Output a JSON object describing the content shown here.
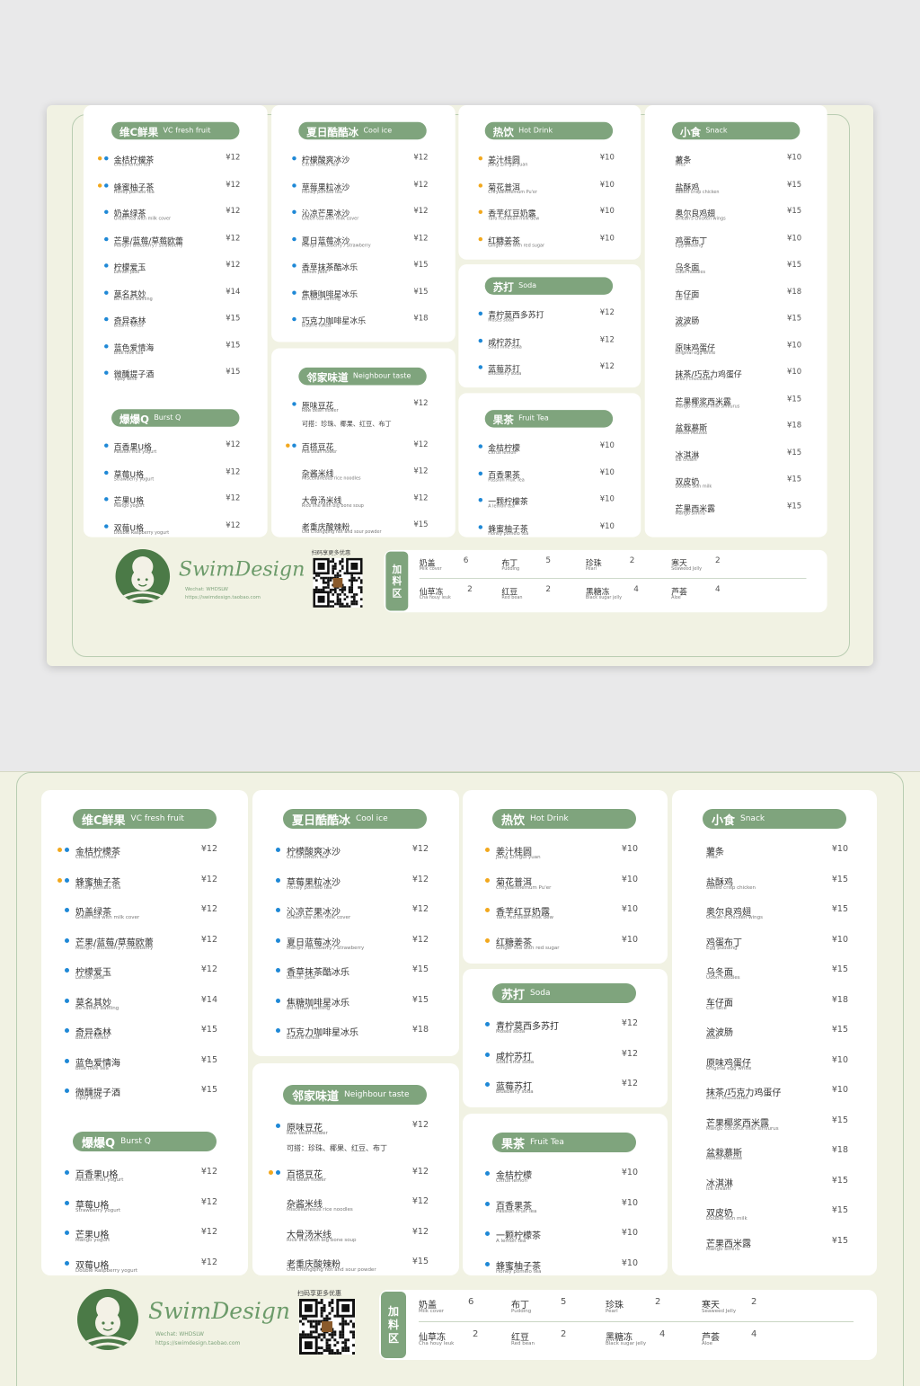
{
  "sections": {
    "vc": {
      "title_cn": "维C鲜果",
      "title_en": "VC fresh fruit",
      "items": [
        {
          "cn": "金桔柠檬茶",
          "en": "Citrus lemon tea",
          "price": "¥12",
          "dots": [
            "orange",
            "blue"
          ]
        },
        {
          "cn": "蜂蜜柚子茶",
          "en": "Honey pomelo tea",
          "price": "¥12",
          "dots": [
            "orange",
            "blue"
          ]
        },
        {
          "cn": "奶盖绿茶",
          "en": "Green tea with milk cover",
          "price": "¥12",
          "dots": [
            "blue"
          ]
        },
        {
          "cn": "芒果/蓝莓/草莓欧蕾",
          "en": "Mango / Blueberry / Strawberry",
          "price": "¥12",
          "dots": [
            "blue"
          ]
        },
        {
          "cn": "柠檬爱玉",
          "en": "Lemon Jade",
          "price": "¥12",
          "dots": [
            "blue"
          ]
        },
        {
          "cn": "莫名其妙",
          "en": "Be rather baffling",
          "price": "¥14",
          "dots": [
            "blue"
          ]
        },
        {
          "cn": "奇异森林",
          "en": "Bizarre forest",
          "price": "¥15",
          "dots": [
            "blue"
          ]
        },
        {
          "cn": "蓝色爱情海",
          "en": "Blue love sea",
          "price": "¥15",
          "dots": [
            "blue"
          ]
        },
        {
          "cn": "微醺提子酒",
          "en": "Tipsy wine",
          "price": "¥15",
          "dots": [
            "blue"
          ]
        }
      ]
    },
    "burst": {
      "title_cn": "爆爆Q",
      "title_en": "Burst Q",
      "items": [
        {
          "cn": "百香果U格",
          "en": "Passion fruit yogurt",
          "price": "¥12",
          "dots": [
            "blue"
          ]
        },
        {
          "cn": "草莓U格",
          "en": "Strawberry yogurt",
          "price": "¥12",
          "dots": [
            "blue"
          ]
        },
        {
          "cn": "芒果U格",
          "en": "Mango yogurt",
          "price": "¥12",
          "dots": [
            "blue"
          ]
        },
        {
          "cn": "双莓U格",
          "en": "Double Raspberry yogurt",
          "price": "¥12",
          "dots": [
            "blue"
          ]
        }
      ]
    },
    "cool": {
      "title_cn": "夏日酷酷冰",
      "title_en": "Cool ice",
      "items": [
        {
          "cn": "柠檬酸爽冰沙",
          "en": "Citrus lemon tea",
          "price": "¥12",
          "dots": [
            "blue"
          ]
        },
        {
          "cn": "草莓果粒冰沙",
          "en": "Honey pomelo tea",
          "price": "¥12",
          "dots": [
            "blue"
          ]
        },
        {
          "cn": "沁凉芒果冰沙",
          "en": "Green tea with milk cover",
          "price": "¥12",
          "dots": [
            "blue"
          ]
        },
        {
          "cn": "夏日蓝莓冰沙",
          "en": "Mango / Blueberry / Strawberry",
          "price": "¥12",
          "dots": [
            "blue"
          ]
        },
        {
          "cn": "香草抹茶酷冰乐",
          "en": "Lemon Jade",
          "price": "¥15",
          "dots": [
            "blue"
          ]
        },
        {
          "cn": "焦糖咖啡星冰乐",
          "en": "Be rather baffling",
          "price": "¥15",
          "dots": [
            "blue"
          ]
        },
        {
          "cn": "巧克力咖啡星冰乐",
          "en": "Bizarre forest",
          "price": "¥18",
          "dots": [
            "blue"
          ]
        }
      ]
    },
    "neighbour": {
      "title_cn": "邻家味道",
      "title_en": "Neighbour taste",
      "items": [
        {
          "cn": "原味豆花",
          "en": "Raw bean flower",
          "price": "¥12",
          "dots": [
            "blue"
          ]
        },
        {
          "cn": "百搭豆花",
          "en": "Pea bean flower",
          "price": "¥12",
          "dots": [
            "orange",
            "blue"
          ]
        },
        {
          "cn": "杂酱米线",
          "en": "Miscellaneous rice noodles",
          "price": "¥12",
          "dots": []
        },
        {
          "cn": "大骨汤米线",
          "en": "Rice line with big bone soup",
          "price": "¥12",
          "dots": []
        },
        {
          "cn": "老重庆酸辣粉",
          "en": "Old Chongqing hot and sour powder",
          "price": "¥15",
          "dots": []
        }
      ],
      "note": "可搭：珍珠、椰果、红豆、布丁"
    },
    "hot": {
      "title_cn": "热饮",
      "title_en": "Hot Drink",
      "items": [
        {
          "cn": "姜汁桂圆",
          "en": "Jiang Zhi gui yuan",
          "price": "¥10",
          "dots": [
            "orange"
          ]
        },
        {
          "cn": "菊花普洱",
          "en": "Chrysanthemum Pu'er",
          "price": "¥10",
          "dots": [
            "orange"
          ]
        },
        {
          "cn": "香芋红豆奶露",
          "en": "Taro red bean milk dew",
          "price": "¥10",
          "dots": [
            "orange"
          ]
        },
        {
          "cn": "红糖姜茶",
          "en": "Ginger tea with red sugar",
          "price": "¥10",
          "dots": [
            "orange"
          ]
        }
      ]
    },
    "soda": {
      "title_cn": "苏打",
      "title_en": "Soda",
      "items": [
        {
          "cn": "青柠莫西多苏打",
          "en": "Moses soda",
          "price": "¥12",
          "dots": [
            "blue"
          ]
        },
        {
          "cn": "咸柠苏打",
          "en": "Soda lime soda",
          "price": "¥12",
          "dots": [
            "blue"
          ]
        },
        {
          "cn": "蓝莓苏打",
          "en": "Blueberry soda",
          "price": "¥12",
          "dots": [
            "blue"
          ]
        }
      ]
    },
    "fruit": {
      "title_cn": "果茶",
      "title_en": "Fruit Tea",
      "items": [
        {
          "cn": "金桔柠檬",
          "en": "Citrus lemon",
          "price": "¥10",
          "dots": [
            "blue"
          ]
        },
        {
          "cn": "百香果茶",
          "en": "Passion Fruit Tea",
          "price": "¥10",
          "dots": [
            "blue"
          ]
        },
        {
          "cn": "一颗柠檬茶",
          "en": "A lemon tea",
          "price": "¥10",
          "dots": [
            "blue"
          ]
        },
        {
          "cn": "蜂蜜柚子茶",
          "en": "Honey pomelo tea",
          "price": "¥10",
          "dots": [
            "blue"
          ]
        }
      ]
    },
    "snack": {
      "title_cn": "小食",
      "title_en": "Snack",
      "items": [
        {
          "cn": "薯条",
          "en": "Fries",
          "price": "¥10",
          "dots": []
        },
        {
          "cn": "盐酥鸡",
          "en": "Salted crisp chicken",
          "price": "¥15",
          "dots": []
        },
        {
          "cn": "奥尔良鸡翅",
          "en": "Orlean's chicken wings",
          "price": "¥15",
          "dots": []
        },
        {
          "cn": "鸡蛋布丁",
          "en": "Egg pudding",
          "price": "¥10",
          "dots": []
        },
        {
          "cn": "乌冬面",
          "en": "Udon noodles",
          "price": "¥15",
          "dots": []
        },
        {
          "cn": "车仔面",
          "en": "Car face",
          "price": "¥18",
          "dots": []
        },
        {
          "cn": "波波肠",
          "en": "Bobo",
          "price": "¥15",
          "dots": []
        },
        {
          "cn": "原味鸡蛋仔",
          "en": "Original egg white",
          "price": "¥10",
          "dots": []
        },
        {
          "cn": "抹茶/巧克力鸡蛋仔",
          "en": "Eras / chocolates",
          "price": "¥10",
          "dots": []
        },
        {
          "cn": "芒果椰浆西米露",
          "en": "Mango coconut milk simiurus",
          "price": "¥15",
          "dots": []
        },
        {
          "cn": "盆栽慕斯",
          "en": "Potted Mousse",
          "price": "¥18",
          "dots": []
        },
        {
          "cn": "冰淇淋",
          "en": "Ice cream",
          "price": "¥15",
          "dots": []
        },
        {
          "cn": "双皮奶",
          "en": "Double skin milk",
          "price": "¥15",
          "dots": []
        },
        {
          "cn": "芒果西米露",
          "en": "Mango simiru",
          "price": "¥15",
          "dots": []
        }
      ]
    }
  },
  "footer": {
    "brand": "SwimDesign",
    "wechat": "Wechat: WHDSLW",
    "url": "https://swimdesign.taobao.com",
    "qr_label": "扫码享更多优惠",
    "addon_title": "加料区",
    "addons": [
      {
        "cn": "奶盖",
        "en": "Milk cover",
        "price": "6"
      },
      {
        "cn": "布丁",
        "en": "Pudding",
        "price": "5"
      },
      {
        "cn": "珍珠",
        "en": "Pearl",
        "price": "2"
      },
      {
        "cn": "寒天",
        "en": "Seaweed Jelly",
        "price": "2"
      },
      {
        "cn": "仙草冻",
        "en": "Cha houy leuk",
        "price": "2"
      },
      {
        "cn": "红豆",
        "en": "Red bean",
        "price": "2"
      },
      {
        "cn": "黑糖冻",
        "en": "Black sugar jelly",
        "price": "4"
      },
      {
        "cn": "芦荟",
        "en": "Aloe",
        "price": "4"
      }
    ]
  },
  "colors": {
    "accent": "#7fa47d",
    "dot_blue": "#1e88d6",
    "dot_orange": "#f2a81d",
    "bg": "#f1f2e3"
  }
}
